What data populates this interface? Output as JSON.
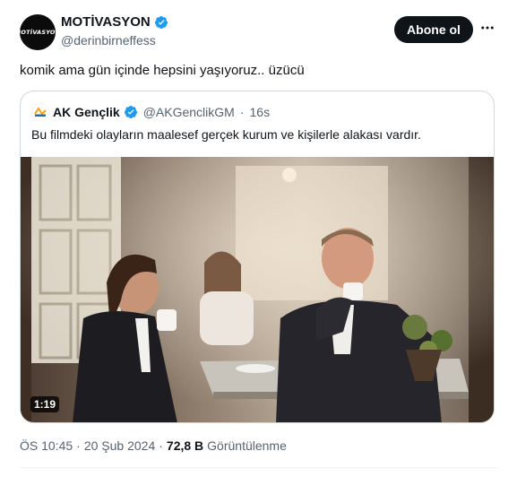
{
  "author": {
    "display_name": "MOTİVASYON",
    "handle": "@derinbirneffess",
    "avatar_text": "MOTİVASYON",
    "verified_color": "#1d9bf0"
  },
  "actions": {
    "follow_label": "Abone ol",
    "more_icon": "more-horizontal-icon"
  },
  "tweet": {
    "text": "komik ama gün içinde hepsini yaşıyoruz.. üzücü"
  },
  "quoted": {
    "display_name": "AK Gençlik",
    "handle": "@AKGenclikGM",
    "time": "16s",
    "text": "Bu filmdeki olayların maalesef gerçek kurum ve kişilerle alakası vardır.",
    "video_duration": "1:19"
  },
  "meta": {
    "time": "ÖS 10:45",
    "date": "20 Şub 2024",
    "views_count": "72,8 B",
    "views_label": "Görüntülenme"
  }
}
